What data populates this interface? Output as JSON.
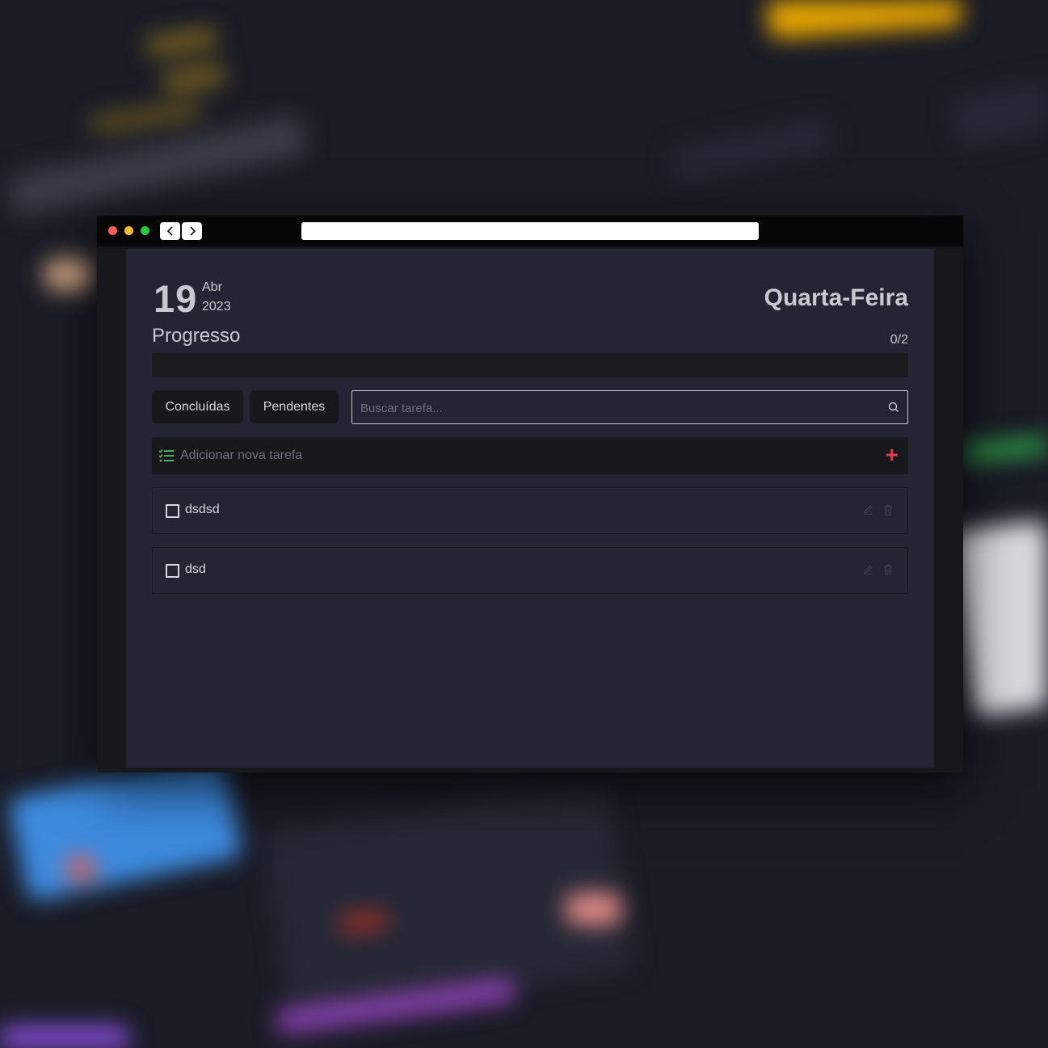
{
  "browser": {
    "url": ""
  },
  "header": {
    "day": "19",
    "month": "Abr",
    "year": "2023",
    "weekday": "Quarta-Feira"
  },
  "progress": {
    "label": "Progresso",
    "count": "0/2",
    "fraction": 0,
    "fill_color": "#2ea04a"
  },
  "filters": {
    "done_label": "Concluídas",
    "pending_label": "Pendentes"
  },
  "search": {
    "placeholder": "Buscar tarefa...",
    "value": "",
    "icon": "search-icon"
  },
  "add_task": {
    "placeholder": "Adicionar nova tarefa",
    "icon": "task-list-icon",
    "button_icon": "plus-icon",
    "accent_color": "#e23a4a"
  },
  "tasks": [
    {
      "label": "dsdsd",
      "checked": false
    },
    {
      "label": "dsd",
      "checked": false
    }
  ],
  "colors": {
    "window_bar": "#070707",
    "app_bg": "#232532",
    "panel_bg": "#17181c",
    "text": "#c8c9cf",
    "list_icon": "#4fc36a"
  }
}
